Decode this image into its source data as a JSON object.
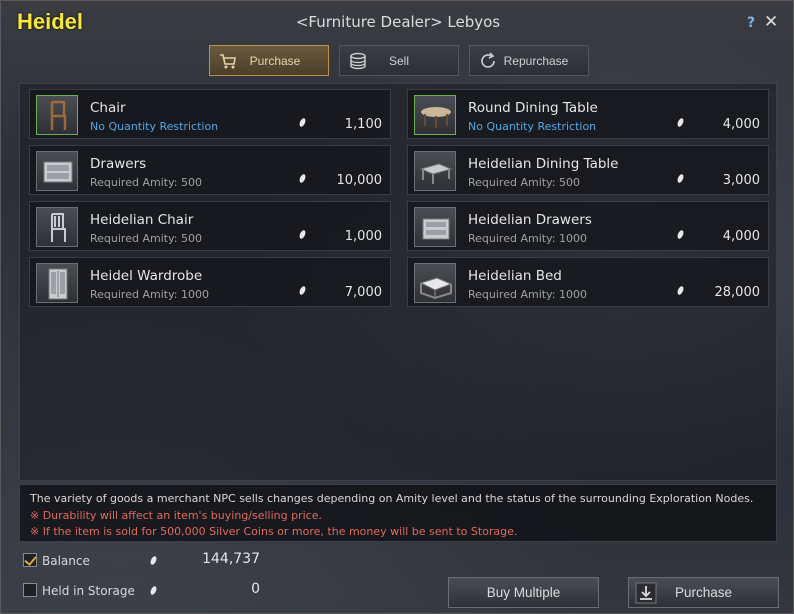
{
  "window": {
    "title": "Heidel",
    "subtitle": "<Furniture Dealer> Lebyos",
    "help": "?",
    "close": "✕"
  },
  "tabs": [
    {
      "label": "Purchase",
      "icon": "cart-icon",
      "active": true
    },
    {
      "label": "Sell",
      "icon": "coins-icon",
      "active": false
    },
    {
      "label": "Repurchase",
      "icon": "refresh-icon",
      "active": false
    }
  ],
  "items": [
    {
      "name": "Chair",
      "requirement": "No Quantity Restriction",
      "price": "1,100",
      "icon": "chair-icon"
    },
    {
      "name": "Round Dining Table",
      "requirement": "No Quantity Restriction",
      "price": "4,000",
      "icon": "round-table-icon"
    },
    {
      "name": "Drawers",
      "requirement": "Required Amity: 500",
      "price": "10,000",
      "icon": "drawers-icon"
    },
    {
      "name": "Heidelian Dining Table",
      "requirement": "Required Amity: 500",
      "price": "3,000",
      "icon": "dining-table-icon"
    },
    {
      "name": "Heidelian Chair",
      "requirement": "Required Amity: 500",
      "price": "1,000",
      "icon": "chair-icon"
    },
    {
      "name": "Heidelian Drawers",
      "requirement": "Required Amity: 1000",
      "price": "4,000",
      "icon": "drawers-icon"
    },
    {
      "name": "Heidel Wardrobe",
      "requirement": "Required Amity: 1000",
      "price": "7,000",
      "icon": "wardrobe-icon"
    },
    {
      "name": "Heidelian Bed",
      "requirement": "Required Amity: 1000",
      "price": "28,000",
      "icon": "bed-icon"
    }
  ],
  "info": {
    "line1": "The variety of goods a merchant NPC sells changes depending on Amity level and the status of the surrounding Exploration Nodes.",
    "line2": "※ Durability will affect an item's buying/selling price.",
    "line3": "※ If the item is sold for 500,000 Silver Coins or more, the money will be sent to Storage."
  },
  "footer": {
    "balance_label": "Balance",
    "balance_value": "144,737",
    "storage_label": "Held in Storage",
    "storage_value": "0",
    "buy_multiple": "Buy Multiple",
    "purchase": "Purchase"
  },
  "colors": {
    "title": "#f6e93a",
    "warning": "#e06a5e",
    "link": "#4fa7e8",
    "active_tab": "#b8924c"
  }
}
